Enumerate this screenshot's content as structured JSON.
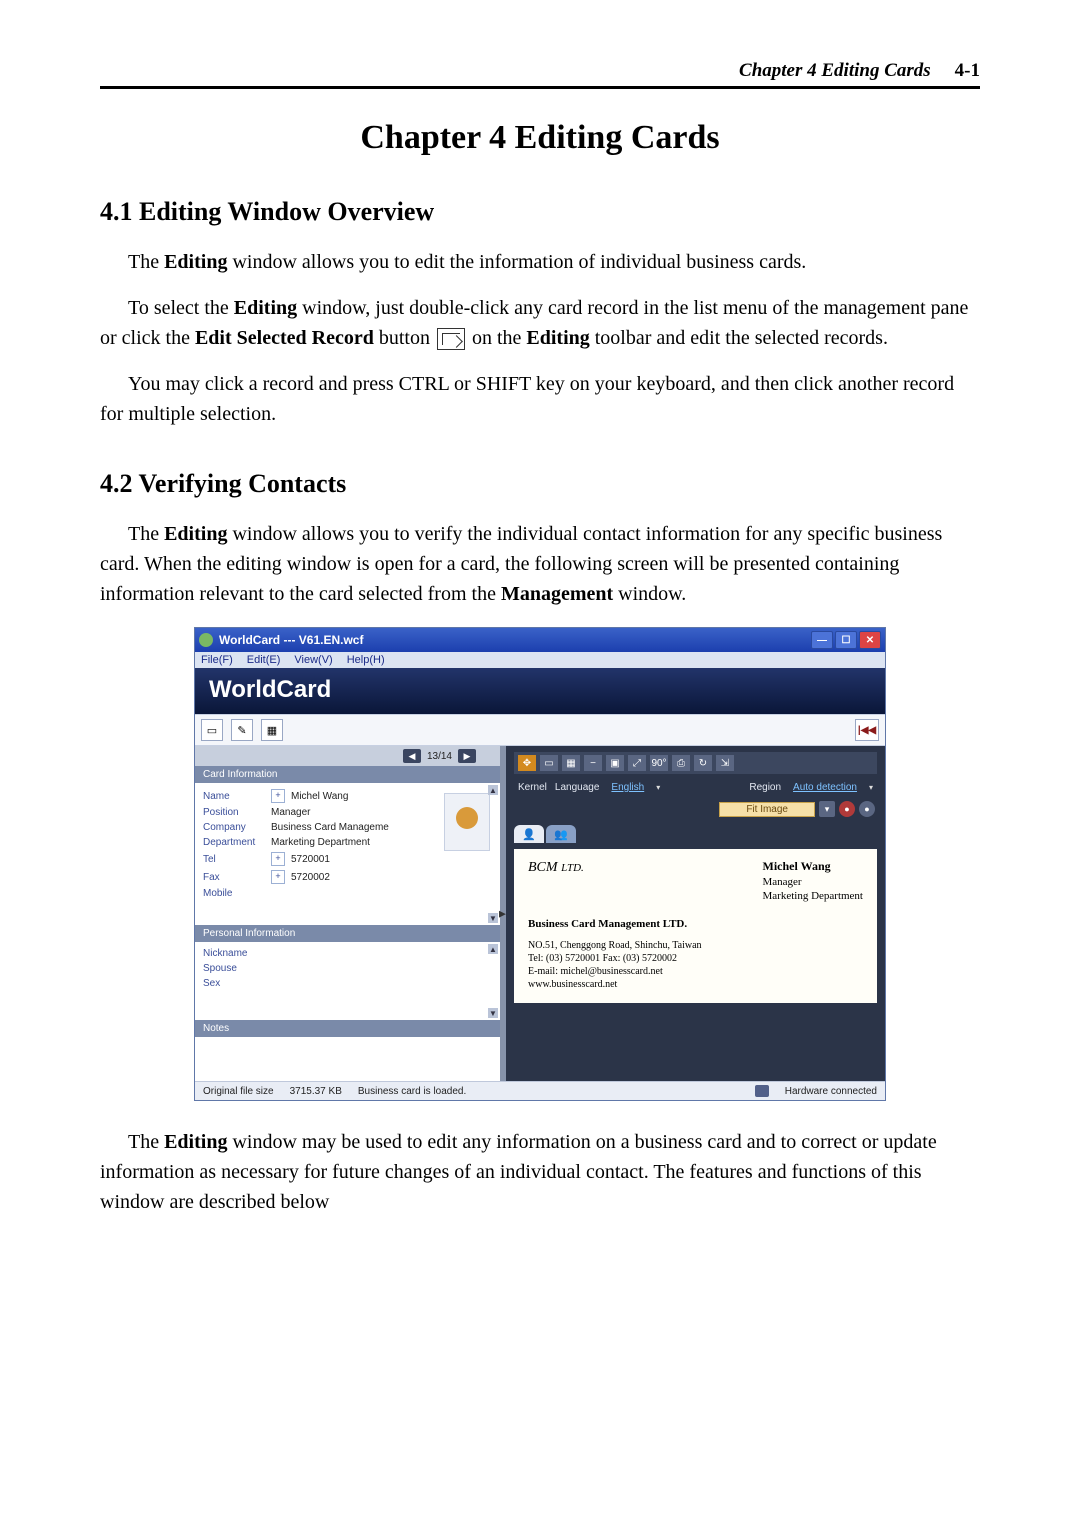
{
  "header": {
    "running": "Chapter 4 Editing Cards",
    "page": "4-1"
  },
  "chapter_title": "Chapter 4 Editing Cards",
  "sec41": {
    "heading": "4.1 Editing Window Overview",
    "p1_a": "The ",
    "p1_b": "Editing",
    "p1_c": " window allows you to edit the information of individual business cards.",
    "p2_a": "To select the ",
    "p2_b": "Editing",
    "p2_c": " window, just double-click any card record in the list menu of the management pane or click the ",
    "p2_d": "Edit Selected Record",
    "p2_e": " button ",
    "p2_f": " on the ",
    "p2_g": "Editing",
    "p2_h": " toolbar and edit the selected records.",
    "p3": "You may click a record and press CTRL or SHIFT key on your keyboard, and then click another record for multiple selection."
  },
  "sec42": {
    "heading": "4.2 Verifying Contacts",
    "p1_a": "The ",
    "p1_b": "Editing",
    "p1_c": " window allows you to verify the individual contact information for any specific business card. When the editing window is open for a card, the following screen will be presented containing information relevant to the card selected from the ",
    "p1_d": "Management",
    "p1_e": " window.",
    "p2_a": "The ",
    "p2_b": "Editing",
    "p2_c": " window may be used to edit any information on a business card and to correct or update information as necessary for future changes of an individual contact. The features and functions of this window are described below"
  },
  "app": {
    "title": "WorldCard --- V61.EN.wcf",
    "menus": {
      "file": "File(F)",
      "edit": "Edit(E)",
      "view": "View(V)",
      "help": "Help(H)"
    },
    "brand": "WorldCard",
    "hide_toggle": "|◀◀",
    "pager": {
      "counter": "13/14"
    },
    "panels": {
      "card_info": "Card Information",
      "personal_info": "Personal Information",
      "notes": "Notes"
    },
    "fields": {
      "name_lbl": "Name",
      "name_val": "Michel Wang",
      "position_lbl": "Position",
      "position_val": "Manager",
      "company_lbl": "Company",
      "company_val": "Business Card Manageme",
      "department_lbl": "Department",
      "department_val": "Marketing Department",
      "tel_lbl": "Tel",
      "tel_val": "5720001",
      "fax_lbl": "Fax",
      "fax_val": "5720002",
      "mobile_lbl": "Mobile",
      "nickname_lbl": "Nickname",
      "spouse_lbl": "Spouse",
      "sex_lbl": "Sex"
    },
    "right": {
      "rot90": "90°",
      "kernel": "Kernel",
      "language_lbl": "Language",
      "language_val": "English",
      "region_lbl": "Region",
      "region_val": "Auto detection",
      "fit_image": "Fit Image"
    },
    "card": {
      "logo": "BCM",
      "logo_sub": "LTD.",
      "name": "Michel Wang",
      "role": "Manager",
      "dept": "Marketing Department",
      "company": "Business Card Management  LTD.",
      "addr1": "NO.51, Chenggong Road, Shinchu, Taiwan",
      "addr2": "Tel: (03) 5720001      Fax: (03) 5720002",
      "addr3": "E-mail: michel@businesscard.net",
      "addr4": "www.businesscard.net"
    },
    "status": {
      "left_label": "Original file size",
      "left_value": "3715.37 KB",
      "left_msg": "Business card is loaded.",
      "right": "Hardware connected"
    }
  }
}
